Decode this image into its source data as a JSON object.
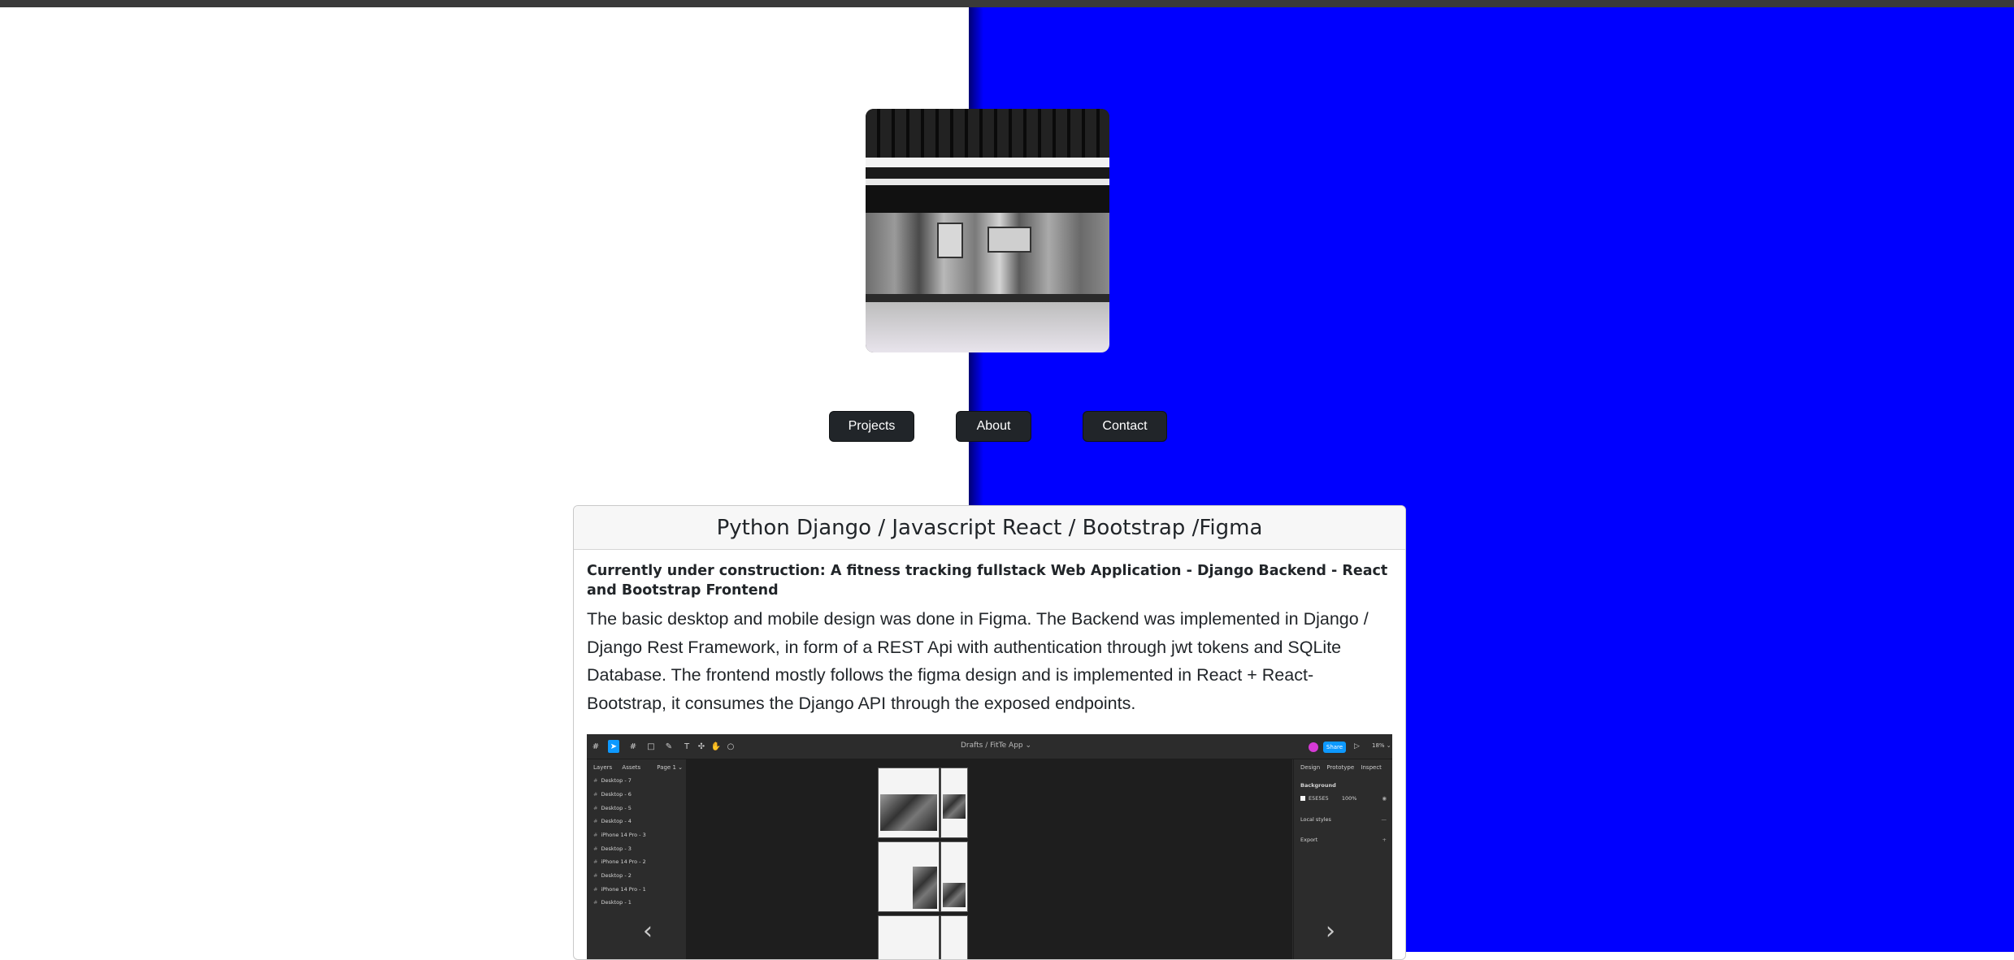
{
  "colors": {
    "accent_panel": "#0000ff",
    "button_bg": "#212529",
    "figma_blue": "#0d99ff"
  },
  "nav": {
    "projects": "Projects",
    "about": "About",
    "contact": "Contact"
  },
  "project_card": {
    "header": "Python Django / Javascript React / Bootstrap /Figma",
    "subtitle": "Currently under construction: A fitness tracking fullstack Web Application - Django Backend - React and Bootstrap Frontend",
    "text": "The basic desktop and mobile design was done in Figma. The Backend was implemented in Django / Django Rest Framework, in form of a REST Api with authentication through jwt tokens and SQLite Database. The frontend mostly follows the figma design and is implemented in React + React-Bootstrap, it consumes the Django API through the exposed endpoints.",
    "carousel": {
      "prev_icon": "chevron-left-icon",
      "next_icon": "chevron-right-icon",
      "prev_glyph": "‹",
      "next_glyph": "›",
      "figma": {
        "title": "Drafts / FitTe App ⌄",
        "share": "Share",
        "zoom": "18% ⌄",
        "left_tabs": [
          "Layers",
          "Assets"
        ],
        "page": "Page 1 ⌄",
        "layers": [
          "Desktop - 7",
          "Desktop - 6",
          "Desktop - 5",
          "Desktop - 4",
          "iPhone 14 Pro - 3",
          "Desktop - 3",
          "iPhone 14 Pro - 2",
          "Desktop - 2",
          "iPhone 14 Pro - 1",
          "Desktop - 1"
        ],
        "right_tabs": [
          "Design",
          "Prototype",
          "Inspect"
        ],
        "background_label": "Background",
        "background_hex": "E5E5E5",
        "background_opacity": "100%",
        "local_styles": "Local styles",
        "export": "Export"
      }
    }
  }
}
